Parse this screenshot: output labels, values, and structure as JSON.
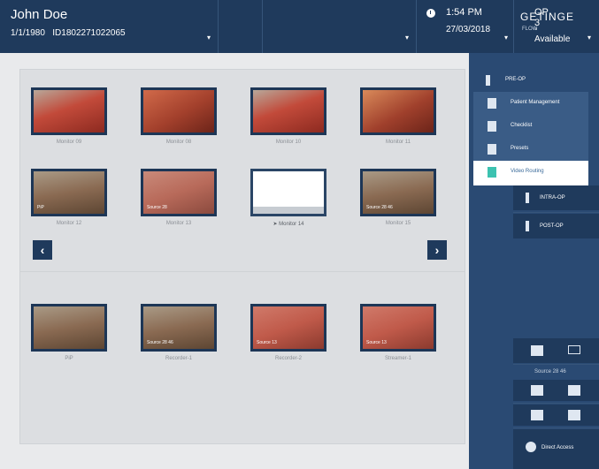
{
  "header": {
    "patient_name": "John Doe",
    "patient_dob": "1/1/1980",
    "patient_id": "ID1802271022065",
    "room": "OP 3",
    "room_status": "Available",
    "time": "1:54 PM",
    "date": "27/03/2018",
    "brand": "GETINGE",
    "brand_sub": "FLOW"
  },
  "monitors_top": [
    {
      "label": "Monitor 09",
      "tag": ""
    },
    {
      "label": "Monitor 08",
      "tag": ""
    },
    {
      "label": "Monitor 10",
      "tag": ""
    },
    {
      "label": "Monitor 11",
      "tag": ""
    },
    {
      "label": "Monitor 12",
      "tag": "PiP"
    },
    {
      "label": "Monitor 13",
      "tag": "Source 28"
    },
    {
      "label": "Monitor 14",
      "tag": ""
    },
    {
      "label": "Monitor 15",
      "tag": "Source 28 46"
    }
  ],
  "recorders": [
    {
      "label": "PiP",
      "tag": ""
    },
    {
      "label": "Recorder-1",
      "tag": "Source 28 46"
    },
    {
      "label": "Recorder-2",
      "tag": "Source 13"
    },
    {
      "label": "Streamer-1",
      "tag": "Source 13"
    }
  ],
  "nav": {
    "prev": "‹",
    "next": "›"
  },
  "menu": {
    "head": "PRE-OP",
    "items": [
      "Patient Management",
      "Checklist",
      "Presets",
      "Video Routing"
    ]
  },
  "side": {
    "intra": "INTRA-OP",
    "post": "POST-OP",
    "source_label": "Source 28 46",
    "direct_access": "Direct Access"
  }
}
